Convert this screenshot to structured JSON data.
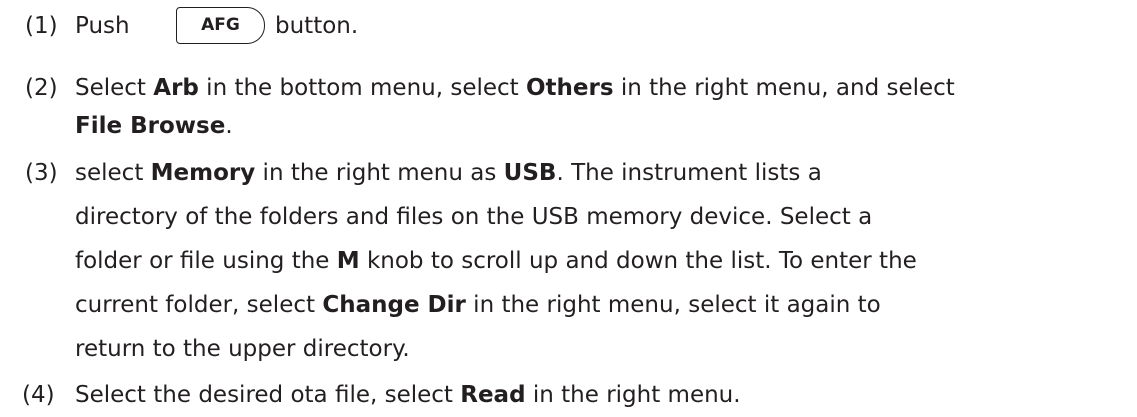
{
  "steps": [
    {
      "num": "(1)",
      "lines": [
        {
          "parts": [
            {
              "t": "Push",
              "b": false
            }
          ]
        },
        {
          "parts": [
            {
              "t": "button.",
              "b": false
            }
          ]
        }
      ],
      "button_label": "AFG"
    },
    {
      "num": "(2)",
      "lines": [
        {
          "parts": [
            {
              "t": "Select ",
              "b": false
            },
            {
              "t": "Arb",
              "b": true
            },
            {
              "t": " in the bottom menu, select ",
              "b": false
            },
            {
              "t": "Others",
              "b": true
            },
            {
              "t": " in the right menu, and select",
              "b": false
            }
          ]
        },
        {
          "parts": [
            {
              "t": "File Browse",
              "b": true
            },
            {
              "t": ".",
              "b": false
            }
          ]
        }
      ]
    },
    {
      "num": "(3)",
      "lines": [
        {
          "parts": [
            {
              "t": "select ",
              "b": false
            },
            {
              "t": "Memory",
              "b": true
            },
            {
              "t": " in the right menu as ",
              "b": false
            },
            {
              "t": "USB",
              "b": true
            },
            {
              "t": ". The instrument lists a",
              "b": false
            }
          ]
        },
        {
          "parts": [
            {
              "t": "directory of the folders and files on the USB memory device. Select a",
              "b": false
            }
          ]
        },
        {
          "parts": [
            {
              "t": "folder or file using the ",
              "b": false
            },
            {
              "t": "M",
              "b": true
            },
            {
              "t": " knob to scroll up and down the list. To enter the",
              "b": false
            }
          ]
        },
        {
          "parts": [
            {
              "t": "current folder, select ",
              "b": false
            },
            {
              "t": "Change Dir",
              "b": true
            },
            {
              "t": " in the right menu, select it again to",
              "b": false
            }
          ]
        },
        {
          "parts": [
            {
              "t": "return to the upper directory.",
              "b": false
            }
          ]
        }
      ]
    },
    {
      "num": "(4)",
      "lines": [
        {
          "parts": [
            {
              "t": "Select the desired ota file, select ",
              "b": false
            },
            {
              "t": "Read",
              "b": true
            },
            {
              "t": " in the right menu.",
              "b": false
            }
          ]
        }
      ]
    }
  ]
}
